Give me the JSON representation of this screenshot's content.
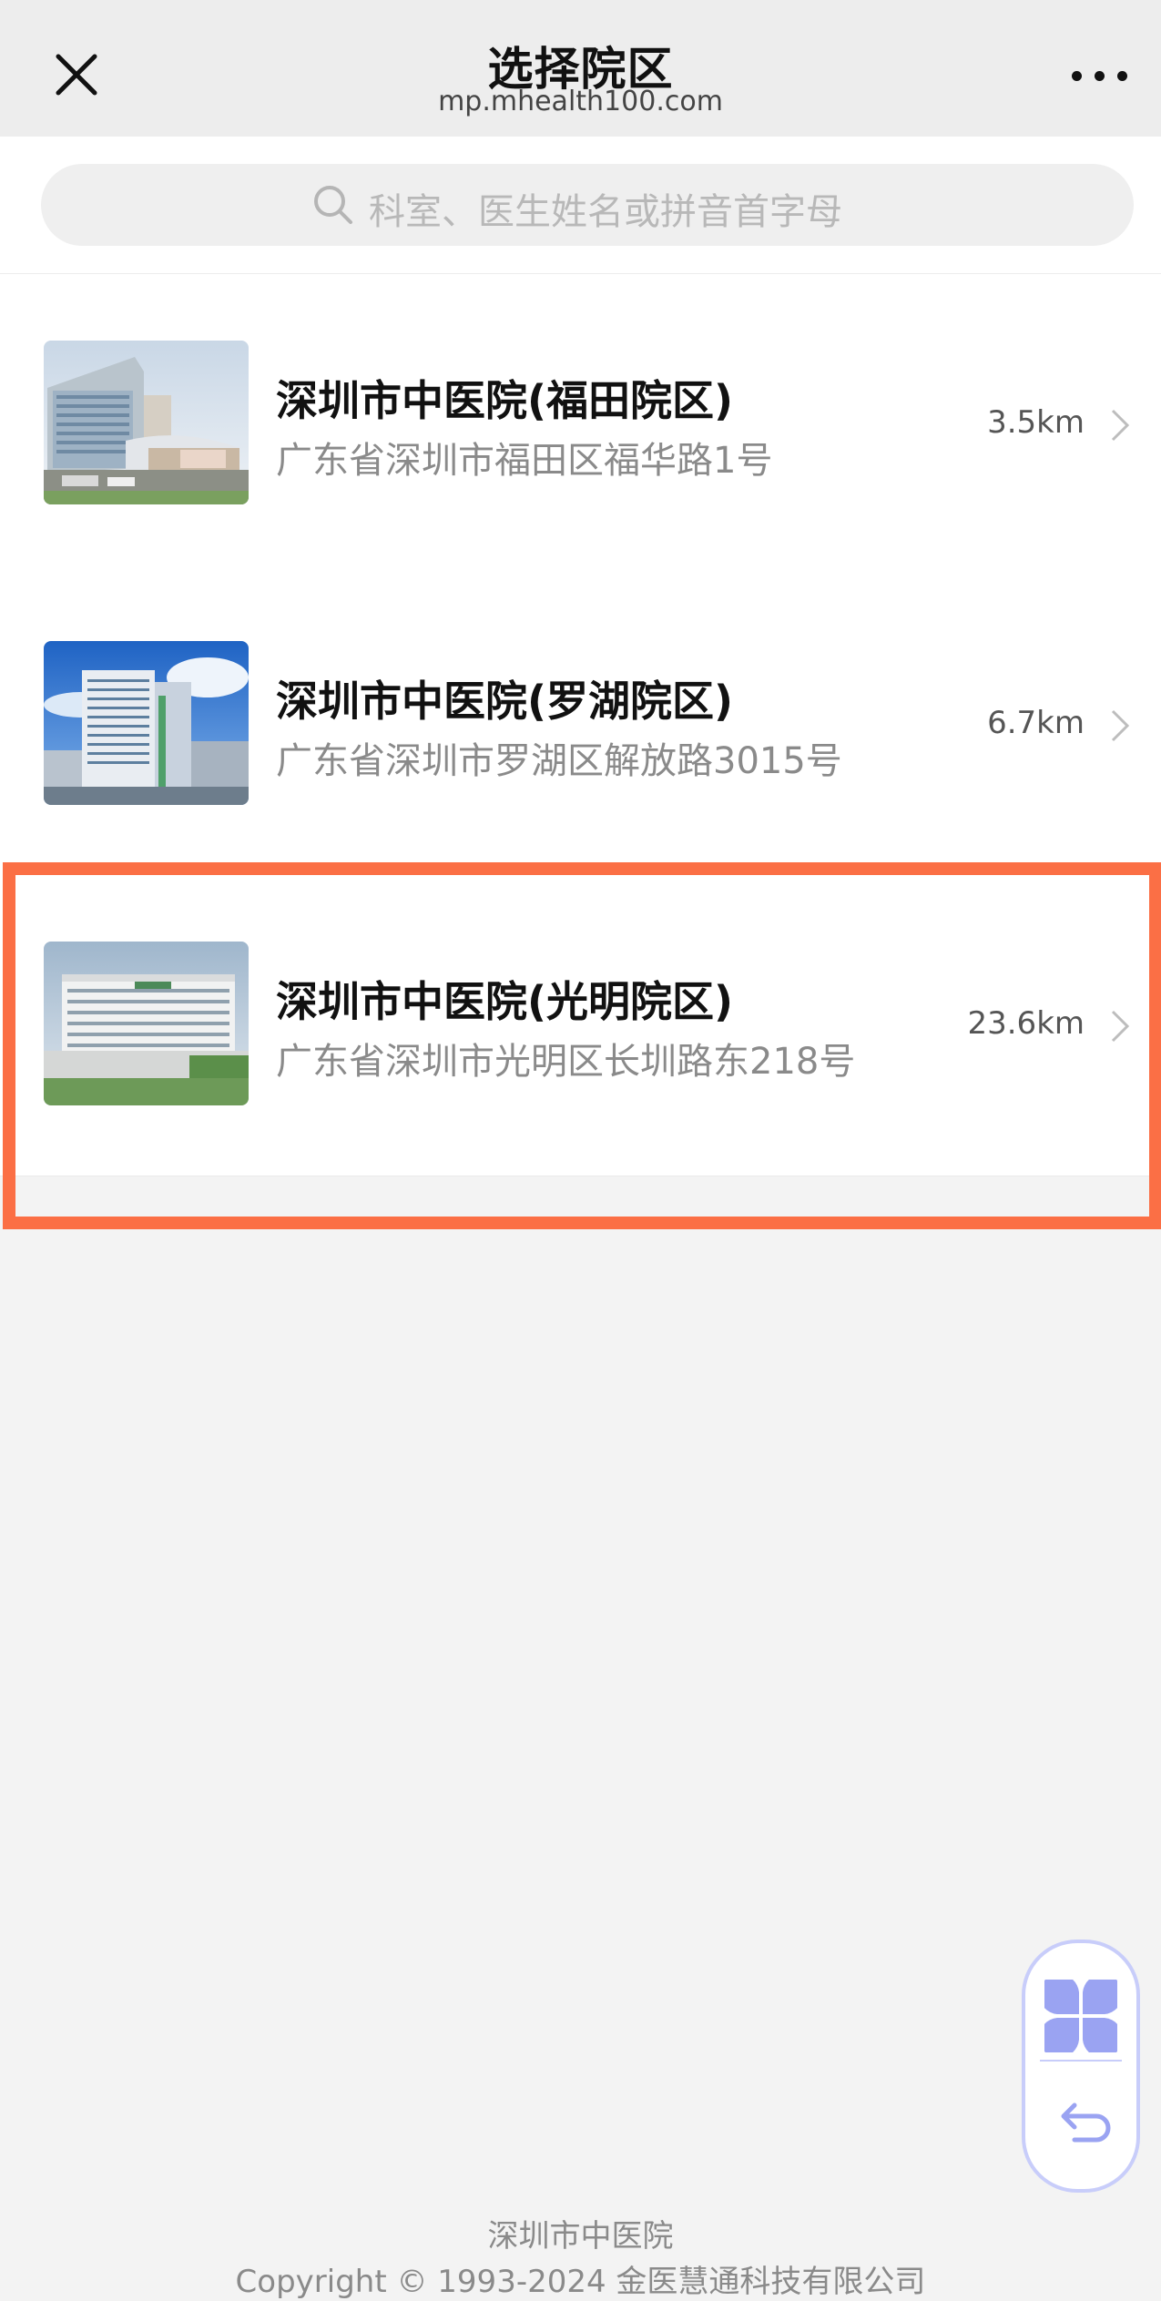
{
  "header": {
    "title": "选择院区",
    "subtitle": "mp.mhealth100.com"
  },
  "search": {
    "placeholder": "科室、医生姓名或拼音首字母"
  },
  "campuses": [
    {
      "name": "深圳市中医院(福田院区)",
      "address": "广东省深圳市福田区福华路1号",
      "distance": "3.5km"
    },
    {
      "name": "深圳市中医院(罗湖院区)",
      "address": "广东省深圳市罗湖区解放路3015号",
      "distance": "6.7km"
    },
    {
      "name": "深圳市中医院(光明院区)",
      "address": "广东省深圳市光明区长圳路东218号",
      "distance": "23.6km"
    }
  ],
  "highlight": {
    "color": "#fb6f45",
    "target": "深圳市中医院(光明院区)"
  },
  "floating_panel": {
    "icons": [
      "apps-icon",
      "back-arrow-icon"
    ],
    "color": "#c8cdfa"
  },
  "footer": {
    "name": "深圳市中医院",
    "copyright": "Copyright © 1993-2024 金医慧通科技有限公司"
  }
}
